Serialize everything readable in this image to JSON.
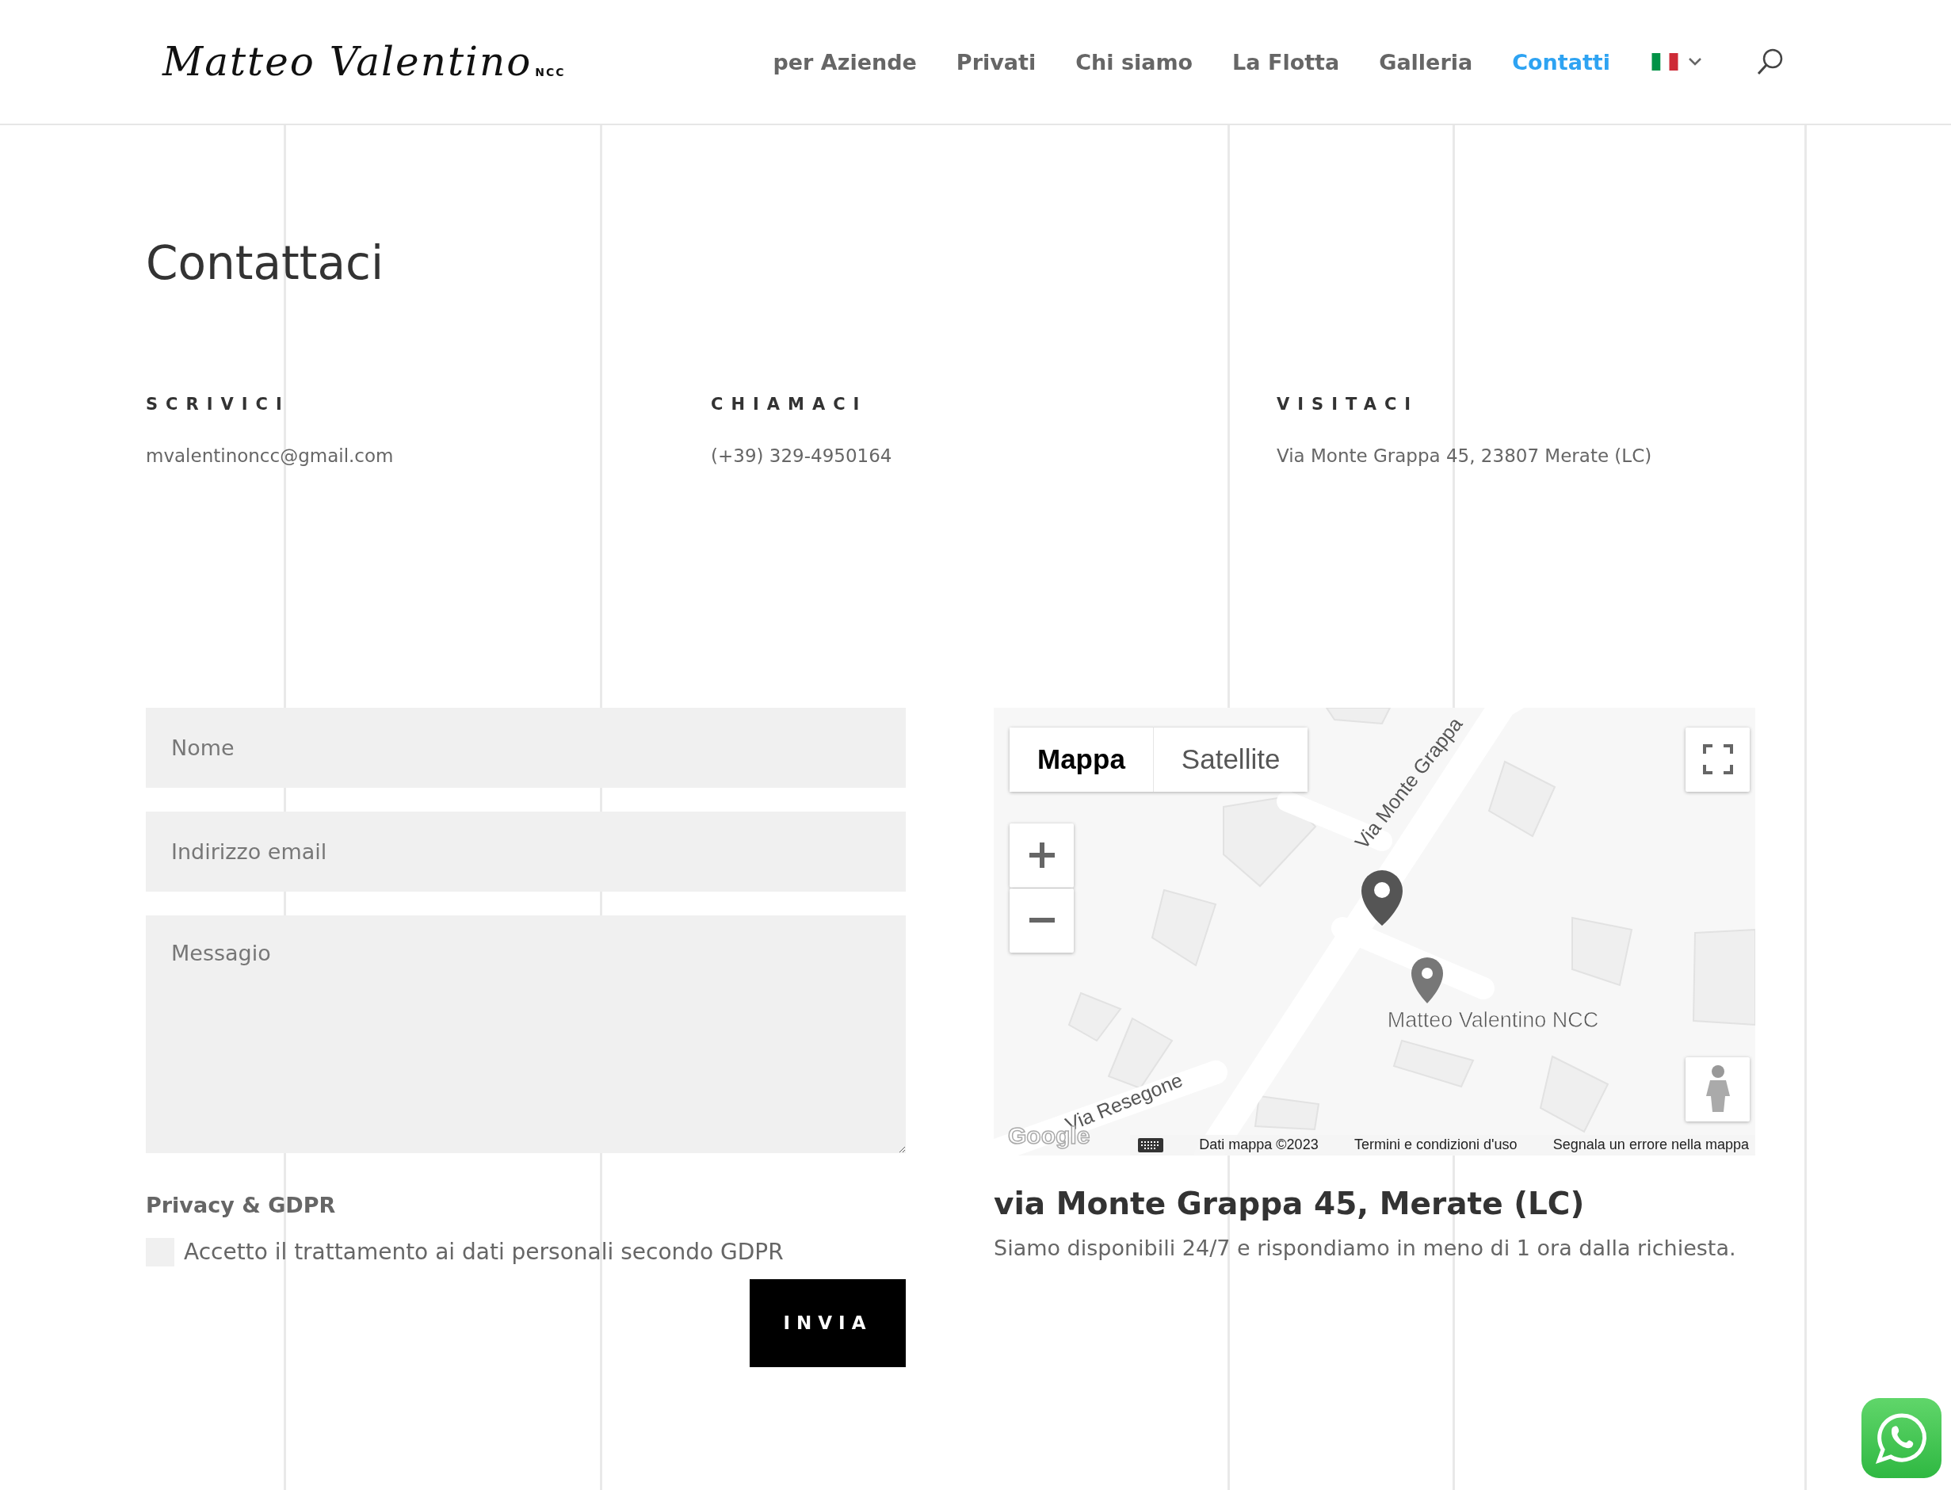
{
  "header": {
    "logo": {
      "name": "Matteo Valentino",
      "tag": "NCC"
    },
    "nav": [
      {
        "label": "per Aziende",
        "selected": false
      },
      {
        "label": "Privati",
        "selected": false
      },
      {
        "label": "Chi siamo",
        "selected": false
      },
      {
        "label": "La Flotta",
        "selected": false
      },
      {
        "label": "Galleria",
        "selected": false
      },
      {
        "label": "Contatti",
        "selected": true
      }
    ]
  },
  "page_title": "Contattaci",
  "contacts": [
    {
      "heading": "SCRIVICI",
      "value": "mvalentinoncc@gmail.com"
    },
    {
      "heading": "CHIAMACI",
      "value": "(+39) 329-4950164"
    },
    {
      "heading": "VISITACI",
      "value": "Via Monte Grappa 45, 23807 Merate (LC)"
    }
  ],
  "form": {
    "fields": [
      {
        "kind": "input",
        "placeholder": "Nome"
      },
      {
        "kind": "input",
        "placeholder": "Indirizzo email"
      },
      {
        "kind": "textarea",
        "placeholder": "Messagio"
      }
    ],
    "consent_title": "Privacy & GDPR",
    "consent": {
      "label": "Accetto il trattamento ai dati personali secondo GDPR",
      "checked": false
    },
    "submit": "INVIA"
  },
  "map": {
    "types": [
      {
        "label": "Mappa",
        "selected": true
      },
      {
        "label": "Satellite",
        "selected": false
      }
    ],
    "roads": [
      "Via Monte Grappa",
      "Via Resegone"
    ],
    "place_label": "Matteo Valentino NCC",
    "logo": "Google",
    "attribution": [
      "Dati mappa ©2023",
      "Termini e condizioni d'uso",
      "Segnala un errore nella mappa"
    ]
  },
  "location": {
    "title": "via Monte Grappa 45, Merate (LC)",
    "description": "Siamo disponibili 24/7 e rispondiamo in meno di 1 ora dalla richiesta."
  }
}
